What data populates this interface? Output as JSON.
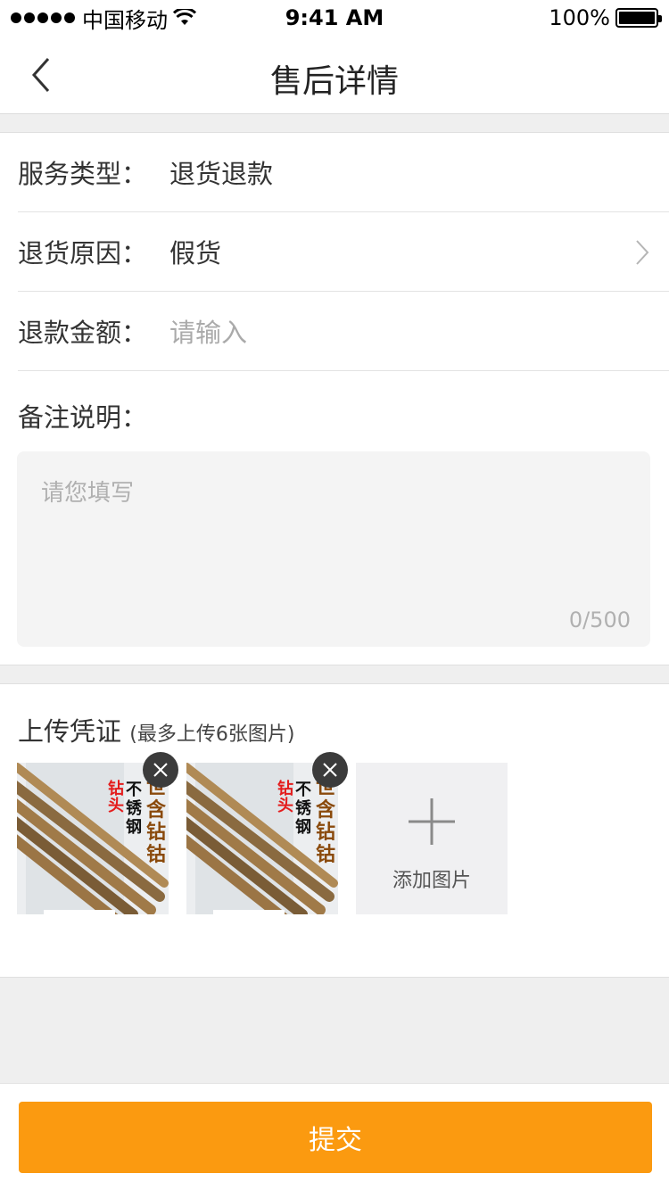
{
  "status_bar": {
    "carrier": "中国移动",
    "time": "9:41 AM",
    "battery": "100%",
    "battery_level": 1.0,
    "signal_icon": "signal-dots-icon",
    "wifi_icon": "wifi-icon"
  },
  "nav": {
    "title": "售后详情",
    "back_icon": "chevron-left-icon"
  },
  "form": {
    "service_type": {
      "label": "服务类型：",
      "value": "退货退款"
    },
    "return_reason": {
      "label": "退货原因：",
      "value": "假货",
      "icon": "chevron-right-icon"
    },
    "refund_amount": {
      "label": "退款金额：",
      "placeholder": "请输入"
    },
    "remark": {
      "label": "备注说明：",
      "placeholder": "请您填写",
      "counter": "0/500"
    }
  },
  "upload": {
    "title": "上传凭证",
    "hint": "(最多上传6张图片)",
    "photos": [
      {
        "text_red": "钻头",
        "text_black": "不锈钢",
        "text_brown": "世含钻钴"
      },
      {
        "text_red": "钻头",
        "text_black": "不锈钢",
        "text_brown": "世含钻钴"
      }
    ],
    "add_label": "添加图片",
    "add_icon": "plus-icon",
    "remove_icon": "close-icon"
  },
  "footer": {
    "submit_label": "提交"
  },
  "colors": {
    "accent": "#fb9a10",
    "page_bg": "#efefef"
  }
}
